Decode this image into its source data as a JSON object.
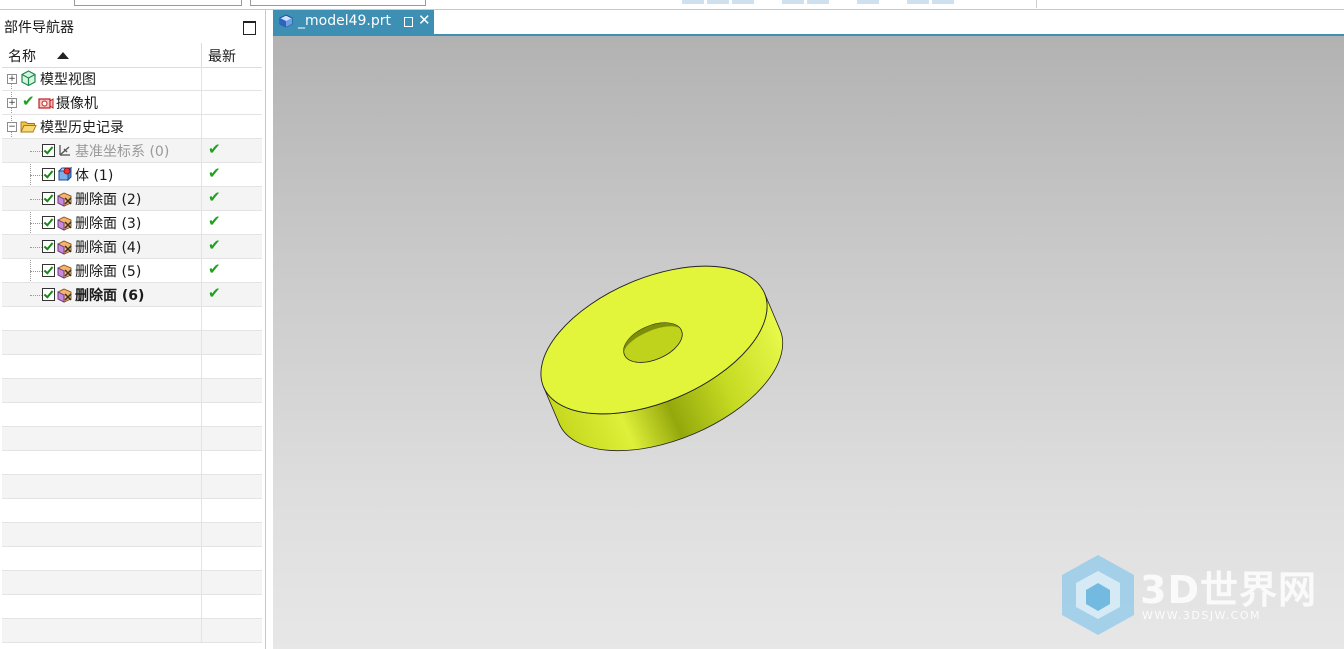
{
  "navigator": {
    "title": "部件导航器",
    "columns": {
      "name": "名称",
      "latest": "最新"
    },
    "rows": [
      {
        "label": "模型视图",
        "icon": "model-views-icon",
        "latest": ""
      },
      {
        "label": "摄像机",
        "icon": "camera-icon",
        "latest": ""
      },
      {
        "label": "模型历史记录",
        "icon": "folder-open-icon",
        "latest": ""
      },
      {
        "label": "基准坐标系 (0)",
        "icon": "datum-csys-icon",
        "latest": "✔"
      },
      {
        "label": "体 (1)",
        "icon": "body-icon",
        "latest": "✔"
      },
      {
        "label": "删除面 (2)",
        "icon": "delete-face-icon",
        "latest": "✔"
      },
      {
        "label": "删除面 (3)",
        "icon": "delete-face-icon",
        "latest": "✔"
      },
      {
        "label": "删除面 (4)",
        "icon": "delete-face-icon",
        "latest": "✔"
      },
      {
        "label": "删除面 (5)",
        "icon": "delete-face-icon",
        "latest": "✔"
      },
      {
        "label": "删除面 (6)",
        "icon": "delete-face-icon",
        "latest": "✔"
      }
    ]
  },
  "graphics": {
    "tab_title": "_model49.prt",
    "part_color": "#e3f53a",
    "accent": "#3d8fb3"
  },
  "watermark": {
    "title": "3D世界网",
    "url": "WWW.3DSJW.COM"
  }
}
